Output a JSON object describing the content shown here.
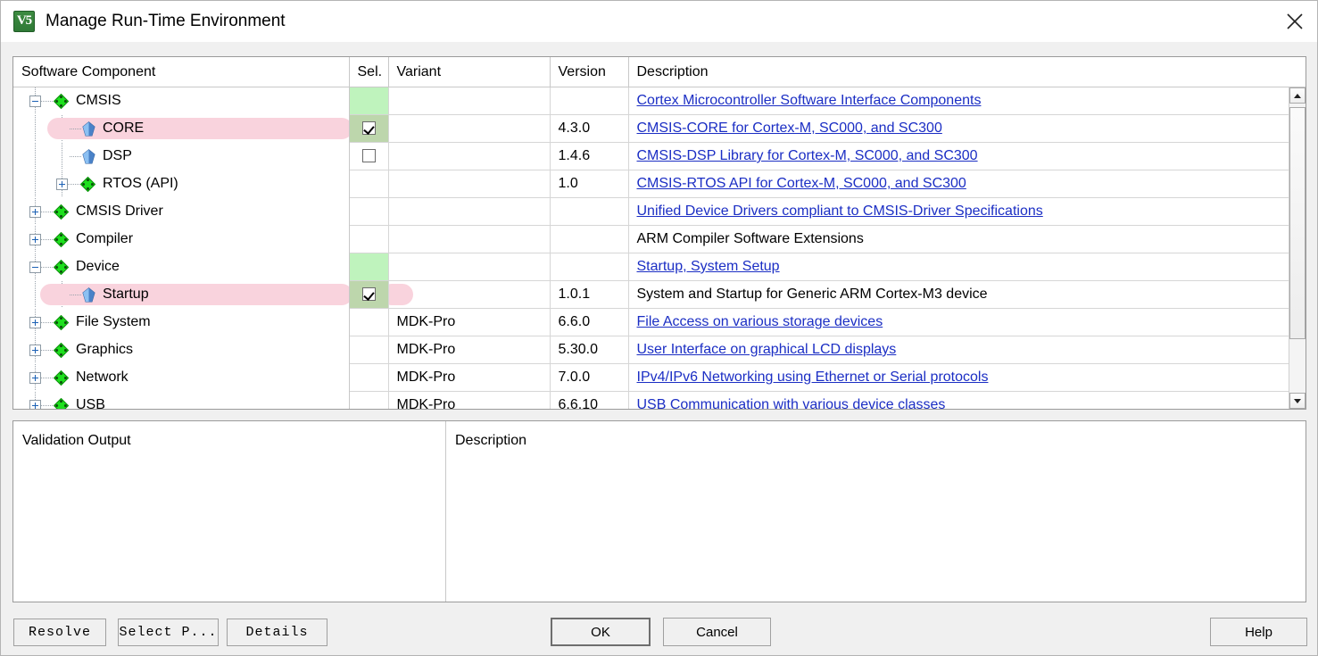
{
  "window": {
    "title": "Manage Run-Time Environment",
    "app_icon": "uvision-logo-icon",
    "close_icon": "close-icon"
  },
  "table": {
    "headers": {
      "component": "Software Component",
      "sel": "Sel.",
      "variant": "Variant",
      "version": "Version",
      "description": "Description"
    },
    "rows": [
      {
        "label": "CMSIS",
        "indent": 0,
        "icon": "green-diamond-icon",
        "expander": "minus",
        "sel_state": "none",
        "sel_cell": "green",
        "variant": "",
        "version": "",
        "description": "Cortex Microcontroller Software Interface Components",
        "desc_is_link": true,
        "highlight": "none"
      },
      {
        "label": "CORE",
        "indent": 1,
        "icon": "blue-diamond-icon",
        "expander": "none",
        "sel_state": "checked",
        "sel_cell": "green",
        "variant": "",
        "version": "4.3.0",
        "description": "CMSIS-CORE for Cortex-M, SC000, and SC300",
        "desc_is_link": true,
        "highlight": "pill-short"
      },
      {
        "label": "DSP",
        "indent": 1,
        "icon": "blue-diamond-icon",
        "expander": "none",
        "sel_state": "unchecked",
        "sel_cell": "white",
        "variant": "",
        "version": "1.4.6",
        "description": "CMSIS-DSP Library for Cortex-M, SC000, and SC300",
        "desc_is_link": true,
        "highlight": "none"
      },
      {
        "label": "RTOS (API)",
        "indent": 1,
        "icon": "green-diamond-icon",
        "expander": "plus",
        "sel_state": "none",
        "sel_cell": "white",
        "variant": "",
        "version": "1.0",
        "description": "CMSIS-RTOS API for Cortex-M, SC000, and SC300",
        "desc_is_link": true,
        "highlight": "none"
      },
      {
        "label": "CMSIS Driver",
        "indent": 0,
        "icon": "green-diamond-icon",
        "expander": "plus",
        "sel_state": "none",
        "sel_cell": "white",
        "variant": "",
        "version": "",
        "description": "Unified Device Drivers compliant to CMSIS-Driver Specifications",
        "desc_is_link": true,
        "highlight": "none"
      },
      {
        "label": "Compiler",
        "indent": 0,
        "icon": "green-diamond-icon",
        "expander": "plus",
        "sel_state": "none",
        "sel_cell": "white",
        "variant": "",
        "version": "",
        "description": "ARM Compiler Software Extensions",
        "desc_is_link": false,
        "highlight": "none"
      },
      {
        "label": "Device",
        "indent": 0,
        "icon": "green-diamond-icon",
        "expander": "minus",
        "sel_state": "none",
        "sel_cell": "green",
        "variant": "",
        "version": "",
        "description": "Startup, System Setup",
        "desc_is_link": true,
        "highlight": "none"
      },
      {
        "label": "Startup",
        "indent": 1,
        "icon": "blue-diamond-icon",
        "expander": "none",
        "sel_state": "checked",
        "sel_cell": "green",
        "variant": "",
        "version": "1.0.1",
        "description": "System and Startup for Generic ARM Cortex-M3 device",
        "desc_is_link": false,
        "highlight": "pill-long"
      },
      {
        "label": "File System",
        "indent": 0,
        "icon": "green-diamond-icon",
        "expander": "plus",
        "sel_state": "none",
        "sel_cell": "white",
        "variant": "MDK-Pro",
        "version": "6.6.0",
        "description": "File Access on various storage devices",
        "desc_is_link": true,
        "highlight": "none"
      },
      {
        "label": "Graphics",
        "indent": 0,
        "icon": "green-diamond-icon",
        "expander": "plus",
        "sel_state": "none",
        "sel_cell": "white",
        "variant": "MDK-Pro",
        "version": "5.30.0",
        "description": "User Interface on graphical LCD displays",
        "desc_is_link": true,
        "highlight": "none"
      },
      {
        "label": "Network",
        "indent": 0,
        "icon": "green-diamond-icon",
        "expander": "plus",
        "sel_state": "none",
        "sel_cell": "white",
        "variant": "MDK-Pro",
        "version": "7.0.0",
        "description": "IPv4/IPv6 Networking using Ethernet or Serial protocols",
        "desc_is_link": true,
        "highlight": "none"
      },
      {
        "label": "USB",
        "indent": 0,
        "icon": "green-diamond-icon",
        "expander": "plus",
        "sel_state": "none",
        "sel_cell": "white",
        "variant": "MDK-Pro",
        "version": "6.6.10",
        "description": "USB Communication with various device classes",
        "desc_is_link": true,
        "highlight": "none"
      }
    ],
    "scrollbar": {
      "up_icon": "scroll-up-arrow-icon",
      "down_icon": "scroll-down-arrow-icon"
    }
  },
  "bottom": {
    "validation_title": "Validation Output",
    "description_title": "Description"
  },
  "buttons": {
    "resolve": "Resolve",
    "select_packs": "Select P...",
    "details": "Details",
    "ok": "OK",
    "cancel": "Cancel",
    "help": "Help"
  },
  "colors": {
    "selected_green": "#bff3bd",
    "highlight_pink": "#f9d3dd",
    "link_blue": "#1b2ec4",
    "icon_green": "#16d61a",
    "icon_blue": "#5a8fd8"
  }
}
